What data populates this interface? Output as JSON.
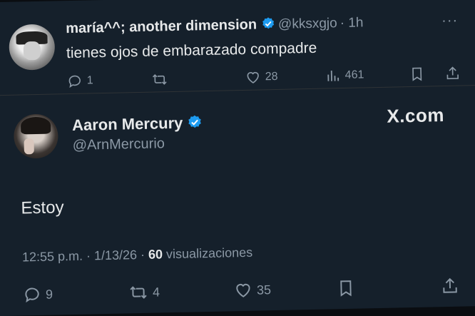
{
  "reply": {
    "name": "maría^^; another dimension",
    "handle": "@kksxgjo",
    "time": "· 1h",
    "more": "···",
    "text": "tienes ojos de embarazado compadre",
    "replies": "1",
    "retweets": "",
    "likes": "28",
    "views": "461"
  },
  "main": {
    "name": "Aaron Mercury",
    "handle": "@ArnMercurio",
    "watermark": "X.com",
    "text": "Estoy",
    "time": "12:55 p.m. · 1/13/26 · ",
    "views_count": "60",
    "views_label": " visualizaciones",
    "replies": "9",
    "retweets": "4",
    "likes": "35"
  },
  "colors": {
    "background": "#15202b",
    "verified": "#1d9bf0",
    "muted": "#8b98a5",
    "text": "#e7e9ea"
  }
}
